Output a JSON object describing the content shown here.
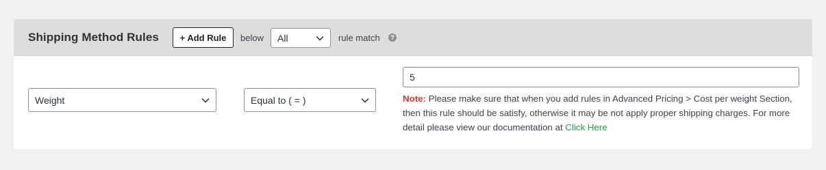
{
  "header": {
    "title": "Shipping Method Rules",
    "add_rule_label": "+ Add Rule",
    "below_text": "below",
    "match_select": {
      "selected": "All"
    },
    "rule_match_text": "rule match",
    "help_icon": "question-circle-icon"
  },
  "rule": {
    "condition_select": {
      "selected": "Weight"
    },
    "operator_select": {
      "selected": "Equal to ( = )"
    },
    "value_input": {
      "value": "5"
    },
    "note": {
      "label": "Note:",
      "text": " Please make sure that when you add rules in Advanced Pricing > Cost per weight Section, then this rule should be satisfy, otherwise it may be not apply proper shipping charges. For more detail please view our documentation at ",
      "link_text": "Click Here"
    }
  },
  "colors": {
    "note_label": "#d63638",
    "link": "#1e9c4a",
    "header_bg": "#dddddd"
  }
}
